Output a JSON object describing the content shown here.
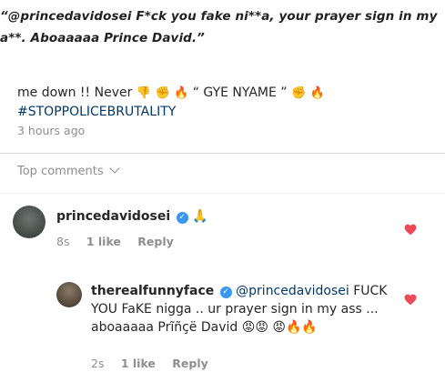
{
  "quote": "“@princedavidosei F*ck you fake ni**a, your prayer sign in my a**. Aboaaaaa Prince David.”",
  "post": {
    "text_line": "me down !! Never",
    "emoji_a": "👎",
    "emoji_b": "✊",
    "emoji_c": "🔥",
    "quote_text": "“ GYE NYAME ”",
    "emoji_d": "✊",
    "emoji_e": "🔥",
    "hashtag": "#STOPPOLICEBRUTALITY",
    "time": "3 hours ago"
  },
  "top_comments_label": "Top comments",
  "comments": [
    {
      "username": "princedavidosei",
      "text": "🙏",
      "age": "8s",
      "likes": "1 like",
      "reply": "Reply"
    },
    {
      "username": "therealfunnyface",
      "mention": "@princedavidosei",
      "text": "FUCK YOU FaKE nigga .. ur prayer sign in my ass ... aboaaaaa Prĩñçë David 😡😡 😡🔥🔥",
      "age": "2s",
      "likes": "1 like",
      "reply": "Reply"
    }
  ],
  "colors": {
    "heart": "#ed4956",
    "verified": "#3897f0",
    "link": "#00376b",
    "muted": "#8e8e8e"
  }
}
